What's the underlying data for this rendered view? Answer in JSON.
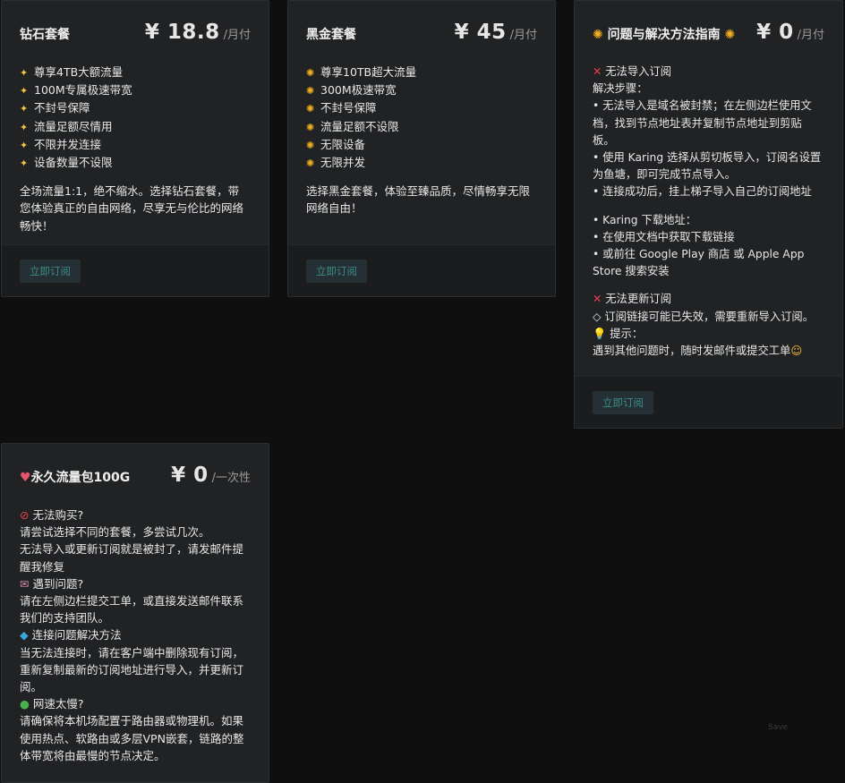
{
  "cards": [
    {
      "title": "钻石套餐",
      "price": "¥ 18.8",
      "period": "/月付",
      "features": [
        "尊享4TB大额流量",
        "100M专属极速带宽",
        "不封号保障",
        "流量足额尽情用",
        "不限并发连接",
        "设备数量不设限"
      ],
      "desc": [
        "全场流量1:1，绝不缩水。选择钻石套餐，带",
        "您体验真正的自由网络，尽享无与伦比的网络",
        "畅快！"
      ],
      "button": "立即订阅"
    },
    {
      "title": "黑金套餐",
      "price": "¥ 45",
      "period": "/月付",
      "features": [
        "尊享10TB超大流量",
        "300M极速带宽",
        "不封号保障",
        "流量足额不设限",
        "无限设备",
        "无限并发"
      ],
      "desc": [
        "选择黑金套餐，体验至臻品质，尽情畅享无限",
        "网络自由！"
      ],
      "button": "立即订阅"
    },
    {
      "title": "问题与解决方法指南",
      "price": "¥ 0",
      "period": "/月付",
      "lines": [
        "无法导入订阅",
        "解决步骤：",
        "• 无法导入是域名被封禁；在左侧边栏使用文",
        "档，找到节点地址表并复制节点地址到剪贴",
        "板。",
        "• 使用 Karing 选择从剪切板导入，订阅名设置",
        "为鱼塘，即可完成节点导入。",
        "• 连接成功后，挂上梯子导入自己的订阅地址",
        "• Karing 下载地址：",
        "• 在使用文档中获取下载链接",
        "• 或前往 Google Play 商店 或 Apple App",
        "Store 搜索安装",
        "无法更新订阅",
        "◇ 订阅链接可能已失效，需要重新导入订阅。",
        "提示：",
        "遇到其他问题时，随时发邮件或提交工单"
      ],
      "button": "立即订阅"
    },
    {
      "title": "永久流量包100G",
      "price": "¥ 0",
      "period": "/一次性",
      "lines": [
        "无法购买?",
        "请尝试选择不同的套餐，多尝试几次。",
        "无法导入或更新订阅就是被封了，请发邮件提",
        "醒我修复",
        "遇到问题?",
        "请在左侧边栏提交工单，或直接发送邮件联系",
        "我们的支持团队。",
        "连接问题解决方法",
        "当无法连接时，请在客户端中删除现有订阅，",
        "重新复制最新的订阅地址进行导入，并更新订",
        "阅。",
        "网速太慢?",
        "请确保将本机场配置于路由器或物理机。如果",
        "使用热点、软路由或多层VPN嵌套，链路的整",
        "体带宽将由最慢的节点决定。"
      ]
    }
  ],
  "save_label": "Save"
}
